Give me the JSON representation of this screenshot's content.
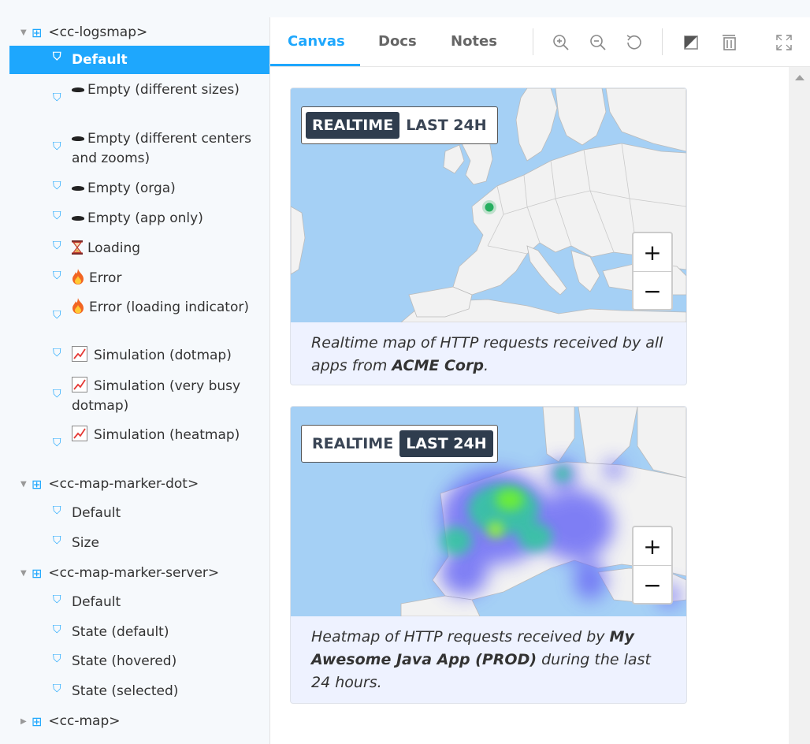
{
  "sidebar": {
    "group_logsmap": "<cc-logsmap>",
    "stories_logsmap": [
      {
        "label": "Default"
      },
      {
        "label": "Empty (different sizes)"
      },
      {
        "label": "Empty (different centers and zooms)"
      },
      {
        "label": "Empty (orga)"
      },
      {
        "label": "Empty (app only)"
      },
      {
        "label": "Loading"
      },
      {
        "label": "Error"
      },
      {
        "label": "Error (loading indicator)"
      },
      {
        "label": "Simulation (dotmap)"
      },
      {
        "label": "Simulation (very busy dotmap)"
      },
      {
        "label": "Simulation (heatmap)"
      }
    ],
    "group_marker_dot": "<cc-map-marker-dot>",
    "stories_marker_dot": [
      {
        "label": "Default"
      },
      {
        "label": "Size"
      }
    ],
    "group_marker_server": "<cc-map-marker-server>",
    "stories_marker_server": [
      {
        "label": "Default"
      },
      {
        "label": "State (default)"
      },
      {
        "label": "State (hovered)"
      },
      {
        "label": "State (selected)"
      }
    ],
    "group_map": "<cc-map>"
  },
  "toolbar": {
    "tabs": [
      "Canvas",
      "Docs",
      "Notes"
    ],
    "active_tab": "Canvas"
  },
  "cards": [
    {
      "toggle": [
        "REALTIME",
        "LAST 24H"
      ],
      "selected": "REALTIME",
      "zoom_in": "+",
      "zoom_out": "−",
      "caption_pre": "Realtime map of HTTP requests received by all apps from ",
      "caption_bold": "ACME Corp",
      "caption_post": "."
    },
    {
      "toggle": [
        "REALTIME",
        "LAST 24H"
      ],
      "selected": "LAST 24H",
      "zoom_in": "+",
      "zoom_out": "−",
      "caption_pre": "Heatmap of HTTP requests received by ",
      "caption_bold": "My Awesome Java App (PROD)",
      "caption_post": " during the last 24 hours."
    }
  ],
  "colors": {
    "accent": "#1ea7fd",
    "toggle_dark": "#2f3d4e",
    "water": "#a5d0f5",
    "land": "#f2f2f2",
    "marker": "#27ae60"
  }
}
